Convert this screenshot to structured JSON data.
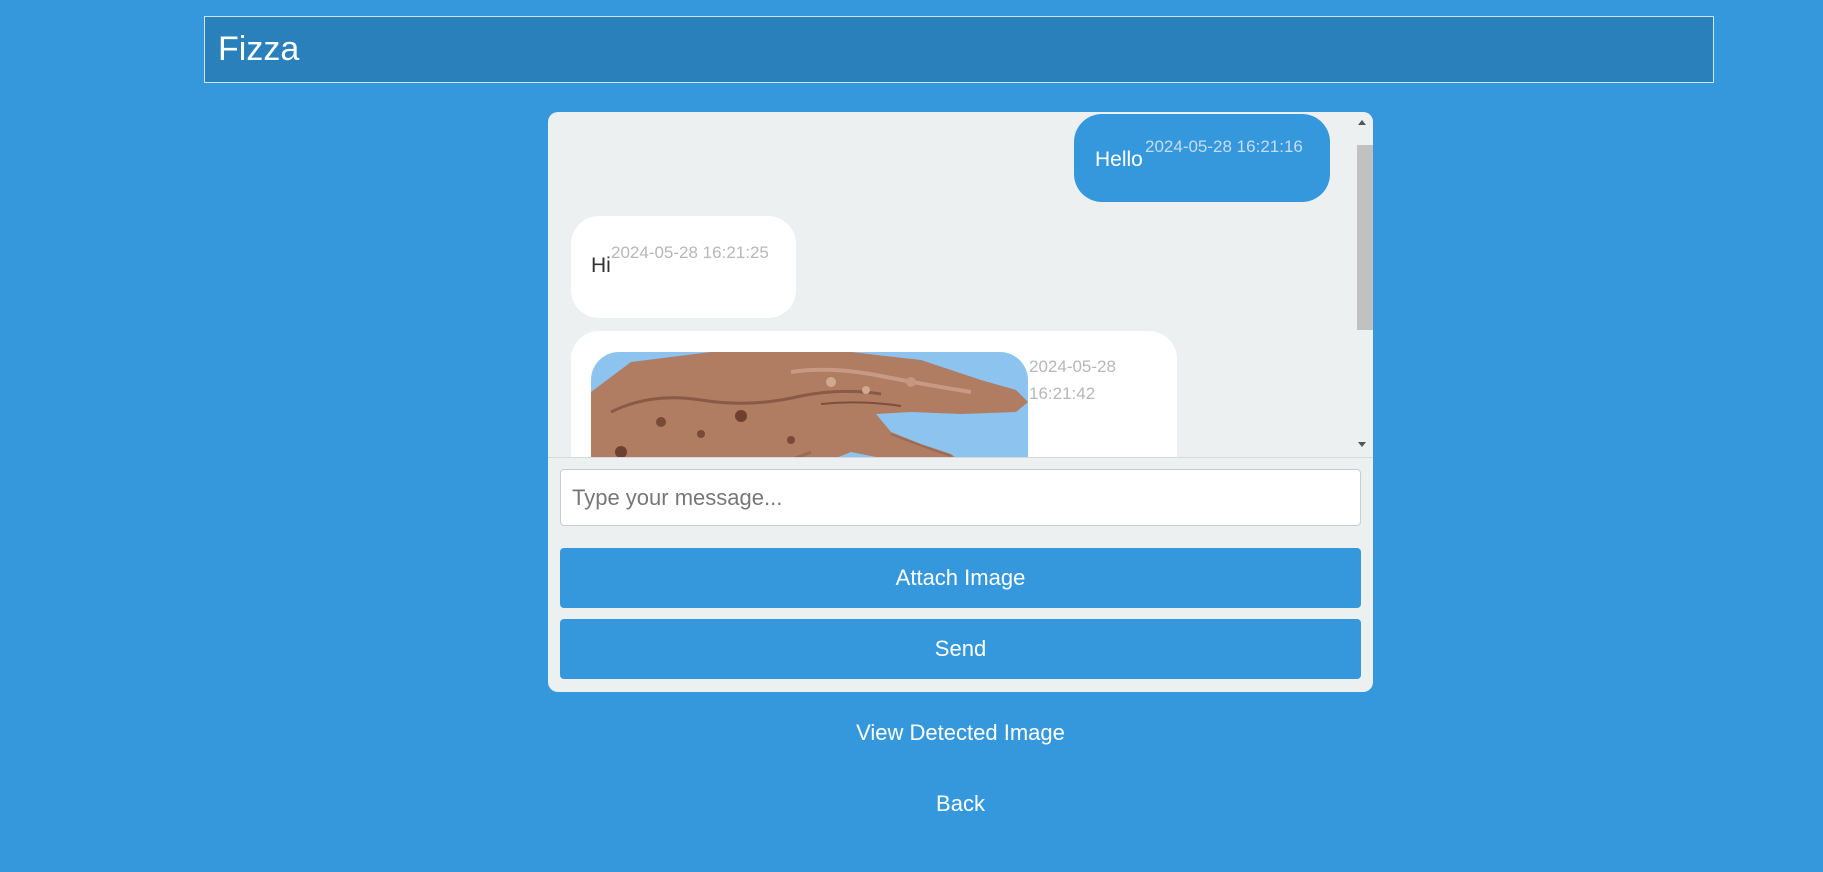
{
  "header": {
    "title": "Fizza"
  },
  "chat": {
    "messages": [
      {
        "type": "sent",
        "text": "Hello",
        "time": "2024-05-28 16:21:16"
      },
      {
        "type": "received",
        "text": "Hi",
        "time": "2024-05-28 16:21:25"
      },
      {
        "type": "image",
        "time": "2024-05-28 16:21:42"
      }
    ]
  },
  "composer": {
    "placeholder": "Type your message...",
    "attach_label": "Attach Image",
    "send_label": "Send"
  },
  "footer_links": {
    "view_detected": "View Detected Image",
    "back": "Back"
  },
  "colors": {
    "page_background": "#3598dc",
    "header_background": "#2980ba",
    "panel_background": "#ecf0f1",
    "button": "#3598dc"
  }
}
